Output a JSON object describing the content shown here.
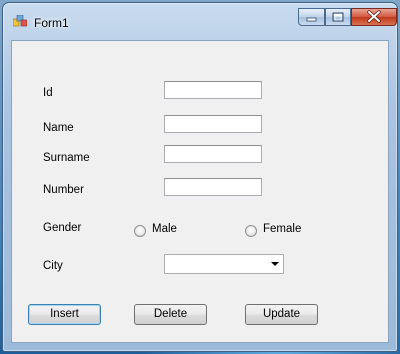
{
  "window": {
    "title": "Form1"
  },
  "form": {
    "id_label": "Id",
    "name_label": "Name",
    "surname_label": "Surname",
    "number_label": "Number",
    "gender_label": "Gender",
    "city_label": "City",
    "id_value": "",
    "name_value": "",
    "surname_value": "",
    "number_value": "",
    "gender_options": [
      "Male",
      "Female"
    ],
    "city_value": ""
  },
  "buttons": {
    "insert": "Insert",
    "delete": "Delete",
    "update": "Update"
  }
}
